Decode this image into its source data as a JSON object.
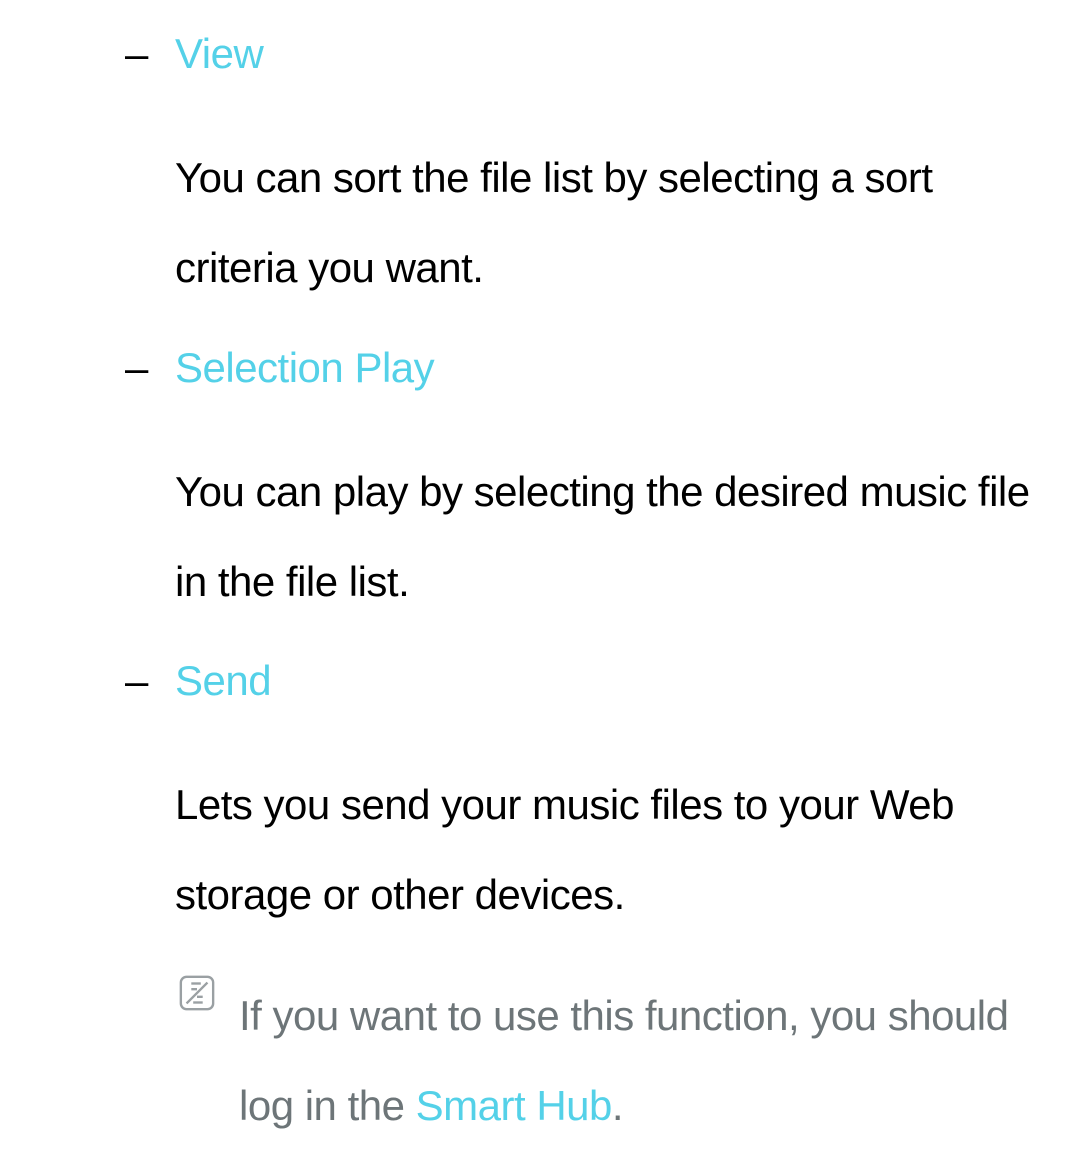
{
  "items": [
    {
      "dash": "–",
      "heading": "View",
      "body": "You can sort the file list by selecting a sort criteria you want."
    },
    {
      "dash": "–",
      "heading": "Selection Play",
      "body": "You can play by selecting the desired music file in the file list."
    },
    {
      "dash": "–",
      "heading": "Send",
      "body": "Lets you send your music files to your Web storage or other devices."
    }
  ],
  "note": {
    "text_before": "If you want to use this function, you should log in the ",
    "link": "Smart Hub",
    "text_after": "."
  }
}
